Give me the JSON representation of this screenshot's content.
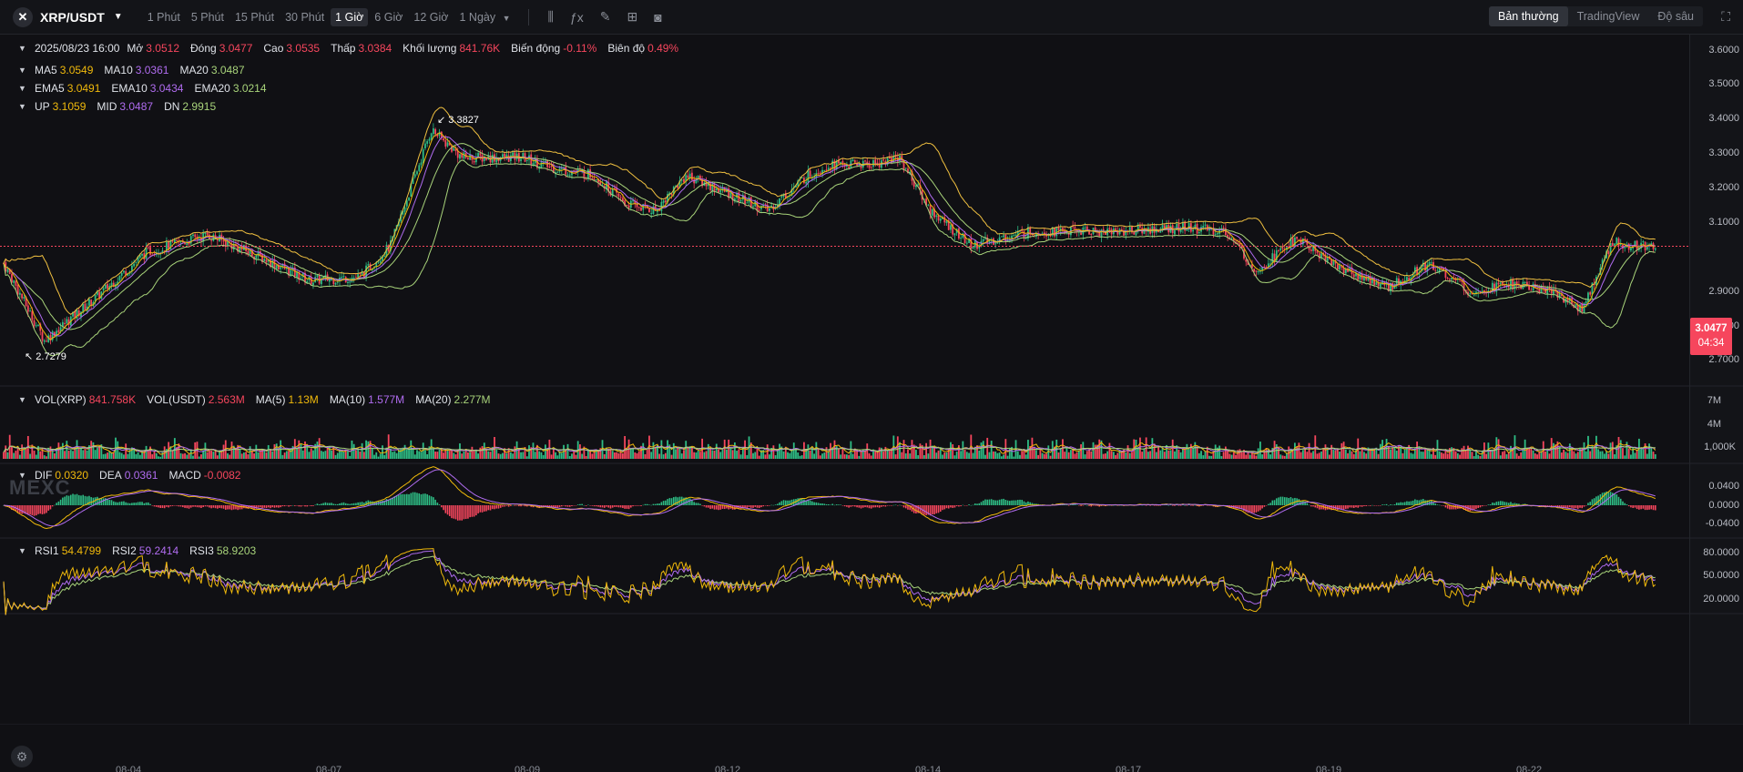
{
  "toolbar": {
    "symbol": "XRP/USDT",
    "timeframes": [
      "1 Phút",
      "5 Phút",
      "15 Phút",
      "30 Phút",
      "1 Giờ",
      "6 Giờ",
      "12 Giờ"
    ],
    "active_timeframe": "1 Giờ",
    "more_timeframe": "1 Ngày",
    "views": [
      "Bản thường",
      "TradingView",
      "Độ sâu"
    ],
    "active_view": "Bản thường"
  },
  "ohlc": {
    "date": "2025/08/23 16:00",
    "open_label": "Mở",
    "open": "3.0512",
    "close_label": "Đóng",
    "close": "3.0477",
    "high_label": "Cao",
    "high": "3.0535",
    "low_label": "Thấp",
    "low": "3.0384",
    "volume_label": "Khối lượng",
    "volume": "841.76K",
    "change_label": "Biến động",
    "change": "-0.11%",
    "amplitude_label": "Biên độ",
    "amplitude": "0.49%"
  },
  "ma": {
    "ma5_label": "MA5",
    "ma5": "3.0549",
    "ma10_label": "MA10",
    "ma10": "3.0361",
    "ma20_label": "MA20",
    "ma20": "3.0487"
  },
  "ema": {
    "ema5_label": "EMA5",
    "ema5": "3.0491",
    "ema10_label": "EMA10",
    "ema10": "3.0434",
    "ema20_label": "EMA20",
    "ema20": "3.0214"
  },
  "boll": {
    "up_label": "UP",
    "up": "3.1059",
    "mid_label": "MID",
    "mid": "3.0487",
    "dn_label": "DN",
    "dn": "2.9915"
  },
  "vol": {
    "vol_xrp_label": "VOL(XRP)",
    "vol_xrp": "841.758K",
    "vol_usdt_label": "VOL(USDT)",
    "vol_usdt": "2.563M",
    "ma5_label": "MA(5)",
    "ma5": "1.13M",
    "ma10_label": "MA(10)",
    "ma10": "1.577M",
    "ma20_label": "MA(20)",
    "ma20": "2.277M"
  },
  "macd": {
    "dif_label": "DIF",
    "dif": "0.0320",
    "dea_label": "DEA",
    "dea": "0.0361",
    "macd_label": "MACD",
    "macd": "-0.0082"
  },
  "rsi": {
    "rsi1_label": "RSI1",
    "rsi1": "54.4799",
    "rsi2_label": "RSI2",
    "rsi2": "59.2414",
    "rsi3_label": "RSI3",
    "rsi3": "58.9203"
  },
  "price_axis": [
    "3.6000",
    "3.5000",
    "3.4000",
    "3.3000",
    "3.2000",
    "3.1000",
    "2.9000",
    "2.8000",
    "2.7000"
  ],
  "vol_axis": [
    "7M",
    "4M",
    "1,000K"
  ],
  "macd_axis": [
    "0.0400",
    "0.0000",
    "-0.0400"
  ],
  "rsi_axis": [
    "80.0000",
    "50.0000",
    "20.0000"
  ],
  "current_price": {
    "price": "3.0477",
    "countdown": "04:34"
  },
  "extremes": {
    "high": "3.3827",
    "low": "2.7279"
  },
  "x_axis": [
    "08-04",
    "08-07",
    "08-09",
    "08-12",
    "08-14",
    "08-17",
    "08-19",
    "08-22"
  ],
  "watermark": "MEXC",
  "colors": {
    "up": "#2ebd85",
    "down": "#f6465d",
    "ma5": "#f0b90b",
    "ma10": "#b06cf0",
    "ma20": "#a8d37a",
    "boll": "#f0c040"
  },
  "chart_data": {
    "type": "candlestick",
    "interval": "1h",
    "price_ylim": [
      2.65,
      3.65
    ],
    "close_path": [
      [
        0,
        3.0
      ],
      [
        20,
        2.78
      ],
      [
        45,
        2.9
      ],
      [
        70,
        3.03
      ],
      [
        100,
        3.08
      ],
      [
        125,
        3.02
      ],
      [
        150,
        2.95
      ],
      [
        175,
        2.96
      ],
      [
        190,
        3.05
      ],
      [
        210,
        3.38
      ],
      [
        225,
        3.3
      ],
      [
        255,
        3.3
      ],
      [
        270,
        3.27
      ],
      [
        290,
        3.25
      ],
      [
        305,
        3.17
      ],
      [
        320,
        3.15
      ],
      [
        335,
        3.25
      ],
      [
        355,
        3.2
      ],
      [
        375,
        3.15
      ],
      [
        395,
        3.25
      ],
      [
        405,
        3.28
      ],
      [
        425,
        3.28
      ],
      [
        440,
        3.3
      ],
      [
        455,
        3.15
      ],
      [
        475,
        3.05
      ],
      [
        505,
        3.09
      ],
      [
        545,
        3.09
      ],
      [
        580,
        3.1
      ],
      [
        600,
        3.09
      ],
      [
        615,
        2.98
      ],
      [
        635,
        3.07
      ],
      [
        655,
        2.99
      ],
      [
        680,
        2.93
      ],
      [
        700,
        3.0
      ],
      [
        720,
        2.92
      ],
      [
        740,
        2.94
      ],
      [
        760,
        2.92
      ],
      [
        775,
        2.87
      ],
      [
        790,
        3.06
      ],
      [
        800,
        3.05
      ],
      [
        812,
        3.05
      ]
    ],
    "series": [
      {
        "name": "MA5"
      },
      {
        "name": "MA10"
      },
      {
        "name": "MA20"
      },
      {
        "name": "UP"
      },
      {
        "name": "MID"
      },
      {
        "name": "DN"
      }
    ]
  }
}
